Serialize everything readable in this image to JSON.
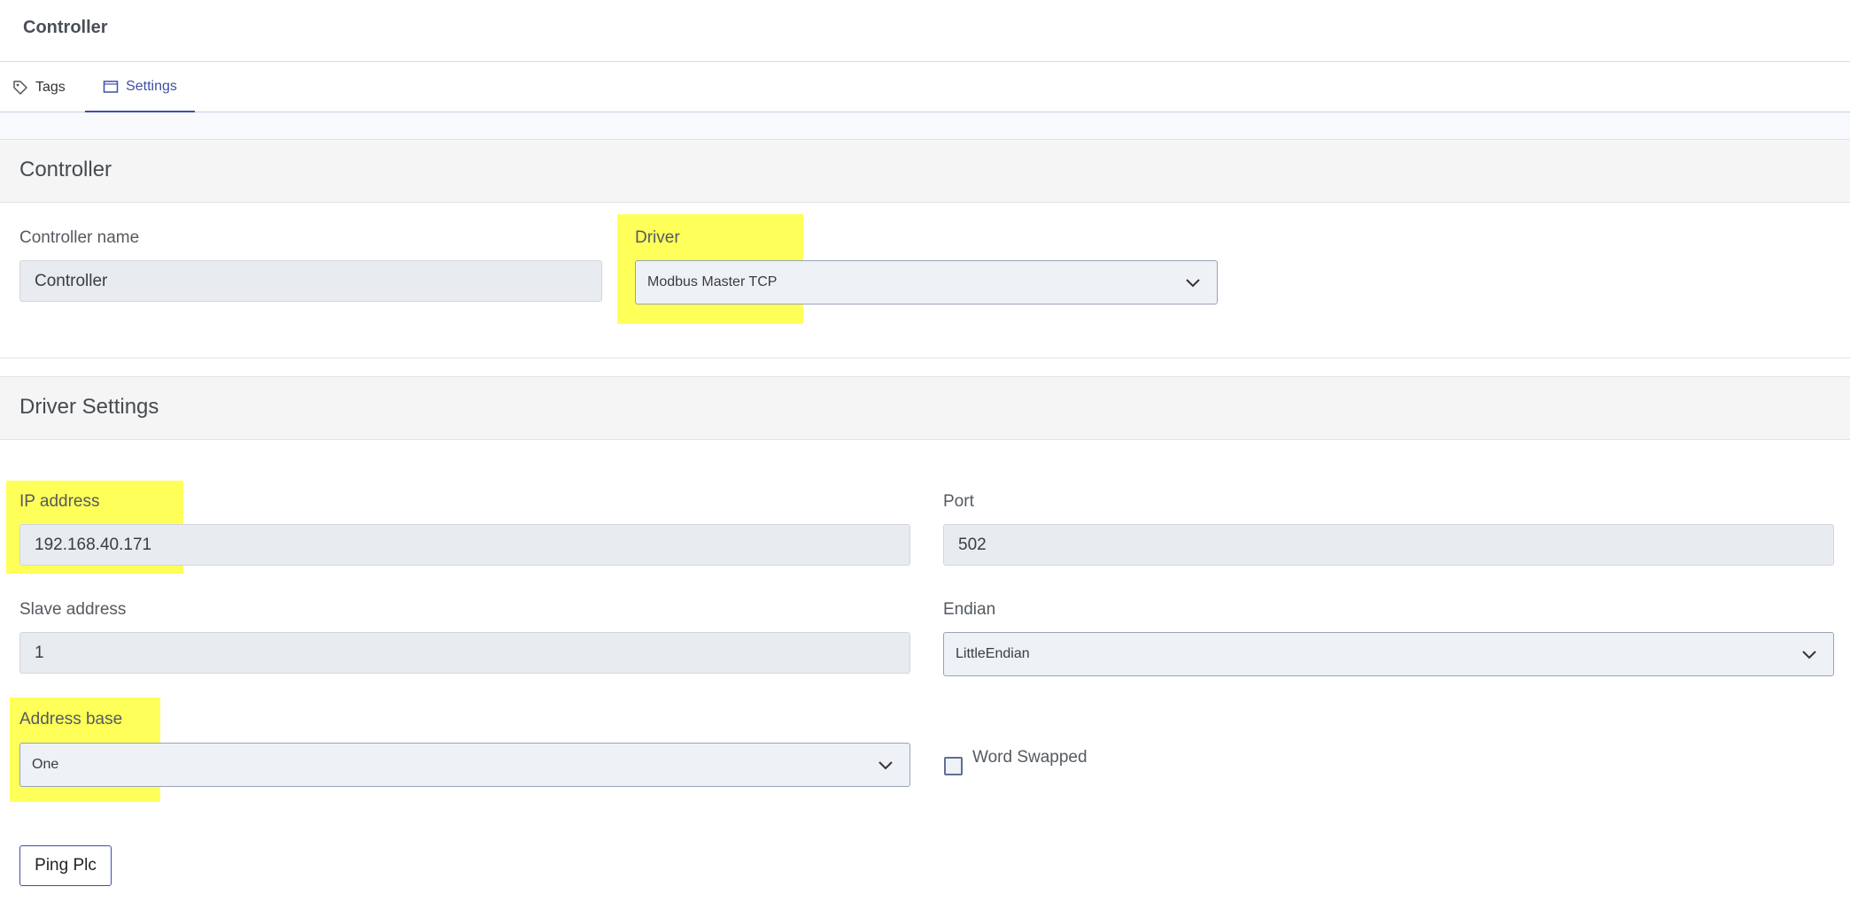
{
  "header": {
    "title": "Controller"
  },
  "tabs": [
    {
      "label": "Tags",
      "icon": "tag-icon"
    },
    {
      "label": "Settings",
      "icon": "window-icon"
    }
  ],
  "controller_section": {
    "title": "Controller",
    "name_label": "Controller name",
    "name_value": "Controller",
    "driver_label": "Driver",
    "driver_value": "Modbus Master TCP"
  },
  "driver_settings": {
    "title": "Driver Settings",
    "ip_label": "IP address",
    "ip_value": "192.168.40.171",
    "port_label": "Port",
    "port_value": "502",
    "slave_label": "Slave address",
    "slave_value": "1",
    "endian_label": "Endian",
    "endian_value": "LittleEndian",
    "address_base_label": "Address base",
    "address_base_value": "One",
    "word_swapped_label": "Word Swapped",
    "word_swapped_checked": false
  },
  "actions": {
    "ping_label": "Ping Plc"
  },
  "colors": {
    "accent": "#3e4fa8",
    "highlight": "#ffff00"
  }
}
